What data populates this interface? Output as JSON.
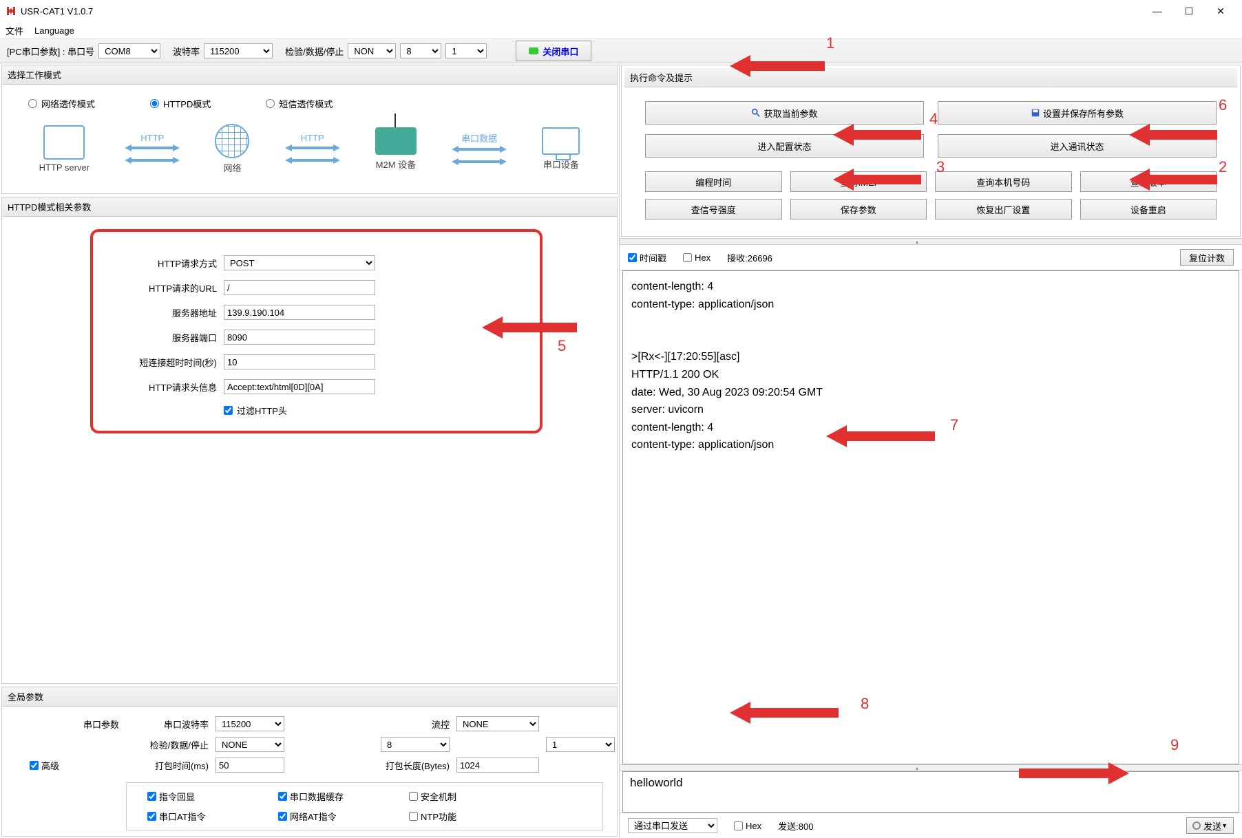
{
  "window": {
    "title": "USR-CAT1 V1.0.7"
  },
  "menu": {
    "file": "文件",
    "language": "Language"
  },
  "winctrl": {
    "min": "—",
    "max": "☐",
    "close": "✕"
  },
  "toolbar": {
    "pc_params_label": "[PC串口参数] : 串口号",
    "com_value": "COM8",
    "baud_label": "波特率",
    "baud_value": "115200",
    "parity_label": "检验/数据/停止",
    "parity_value": "NONE",
    "data_value": "8",
    "stop_value": "1",
    "port_btn": "关闭串口"
  },
  "mode_box": {
    "title": "选择工作模式",
    "r1": "网络透传模式",
    "r2": "HTTPD模式",
    "r3": "短信透传模式",
    "diag": {
      "server": "HTTP server",
      "http": "HTTP",
      "net": "网络",
      "m2m": "M2M 设备",
      "serial_data": "串口数据",
      "serial_dev": "串口设备"
    }
  },
  "httpd_box": {
    "title": "HTTPD模式相关参数",
    "method_label": "HTTP请求方式",
    "method_value": "POST",
    "url_label": "HTTP请求的URL",
    "url_value": "/",
    "addr_label": "服务器地址",
    "addr_value": "139.9.190.104",
    "port_label": "服务器端口",
    "port_value": "8090",
    "timeout_label": "短连接超时时间(秒)",
    "timeout_value": "10",
    "header_label": "HTTP请求头信息",
    "header_value": "Accept:text/html[0D][0A]",
    "filter_label": "过滤HTTP头"
  },
  "global_box": {
    "title": "全局参数",
    "serial_params": "串口参数",
    "baud_label": "串口波特率",
    "baud_value": "115200",
    "flow_label": "流控",
    "flow_value": "NONE",
    "pds_label": "检验/数据/停止",
    "pds_parity": "NONE",
    "pds_data": "8",
    "pds_stop": "1",
    "pack_time_label": "打包时间(ms)",
    "pack_time_value": "50",
    "pack_len_label": "打包长度(Bytes)",
    "pack_len_value": "1024",
    "advanced": "高级",
    "c1": "指令回显",
    "c2": "串口数据缓存",
    "c3": "安全机制",
    "c4": "串口AT指令",
    "c5": "网络AT指令",
    "c6": "NTP功能"
  },
  "cmd_box": {
    "title": "执行命令及提示",
    "get_params": "获取当前参数",
    "set_save": "设置并保存所有参数",
    "enter_config": "进入配置状态",
    "enter_comm": "进入通讯状态",
    "compile_time": "编程时间",
    "query_imei": "查询IMEI",
    "query_number": "查询本机号码",
    "query_version": "查询版本",
    "signal": "查信号强度",
    "save_params": "保存参数",
    "factory": "恢复出厂设置",
    "reboot": "设备重启"
  },
  "rx": {
    "timestamp_label": "时间戳",
    "hex_label": "Hex",
    "recv_label": "接收:26696",
    "reset_btn": "复位计数",
    "content": "content-length: 4\ncontent-type: application/json\n\n\n>[Rx<-][17:20:55][asc]\nHTTP/1.1 200 OK\ndate: Wed, 30 Aug 2023 09:20:54 GMT\nserver: uvicorn\ncontent-length: 4\ncontent-type: application/json"
  },
  "tx": {
    "content": "helloworld",
    "send_via_label": "通过串口发送",
    "hex_label": "Hex",
    "send_count": "发送:800",
    "send_btn": "发送"
  },
  "annot": {
    "n1": "1",
    "n2": "2",
    "n3": "3",
    "n4": "4",
    "n5": "5",
    "n6": "6",
    "n7": "7",
    "n8": "8",
    "n9": "9"
  }
}
